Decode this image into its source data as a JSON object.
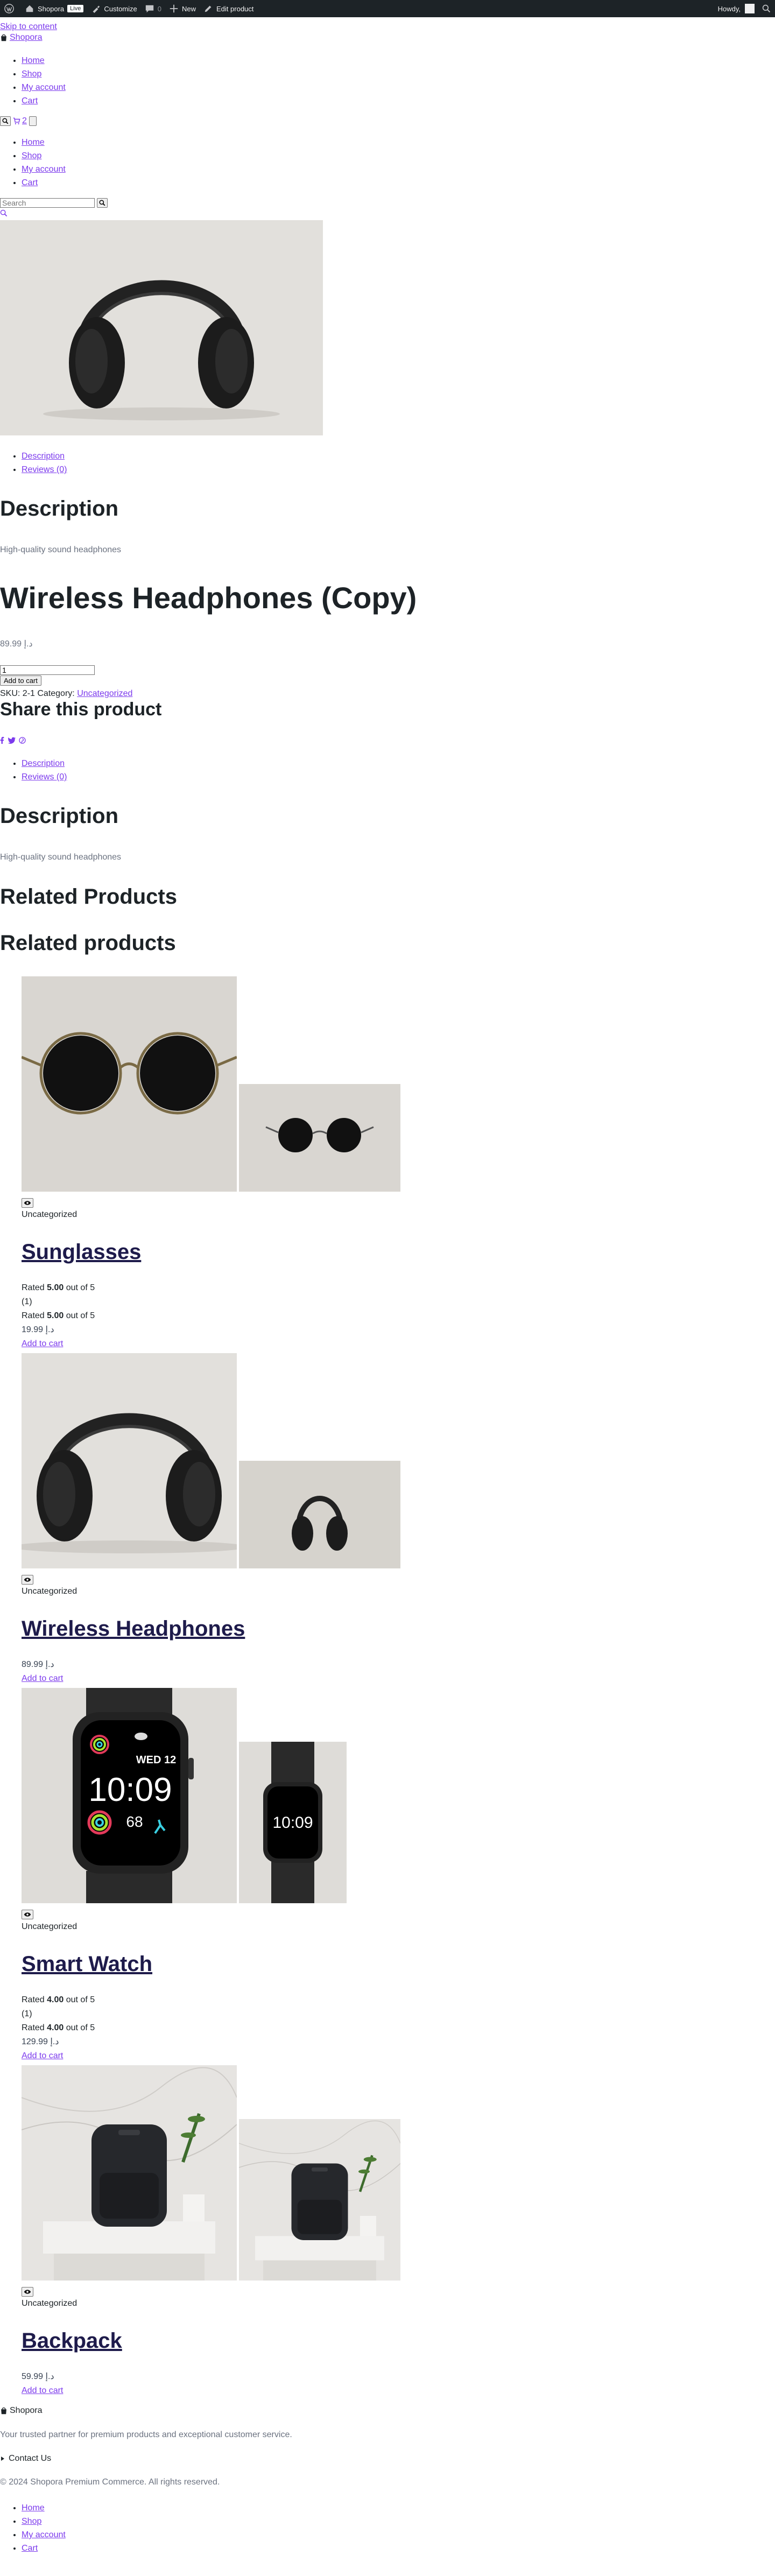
{
  "adminbar": {
    "site_name": "Shopora",
    "live_badge": "Live",
    "customize": "Customize",
    "comments_count": "0",
    "new_label": "New",
    "edit_product": "Edit product",
    "howdy": "Howdy,"
  },
  "header": {
    "skip_link": "Skip to content",
    "brand": "Shopora",
    "nav": [
      "Home",
      "Shop",
      "My account",
      "Cart"
    ],
    "cart_count": "2"
  },
  "search": {
    "placeholder": "Search"
  },
  "product": {
    "tabs": [
      "Description",
      "Reviews (0)"
    ],
    "description_heading": "Description",
    "description_text": "High-quality sound headphones",
    "title": "Wireless Headphones (Copy)",
    "price": "د.إ 89.99",
    "quantity": "1",
    "add_to_cart": "Add to cart",
    "sku_label": "SKU: 2-1 Category:",
    "category": "Uncategorized",
    "share_heading": "Share this product"
  },
  "related": {
    "heading1": "Related Products",
    "heading2": "Related products",
    "items": [
      {
        "category": "Uncategorized",
        "name": "Sunglasses",
        "rating_prefix": "Rated ",
        "rating_value": "5.00",
        "rating_suffix": " out of 5",
        "review_count": "(1)",
        "price": "د.إ 19.99",
        "cta": "Add to cart"
      },
      {
        "category": "Uncategorized",
        "name": "Wireless Headphones",
        "price": "د.إ 89.99",
        "cta": "Add to cart"
      },
      {
        "category": "Uncategorized",
        "name": "Smart Watch",
        "rating_prefix": "Rated ",
        "rating_value": "4.00",
        "rating_suffix": " out of 5",
        "review_count": "(1)",
        "price": "د.إ 129.99",
        "cta": "Add to cart",
        "watch_date": "WED 12",
        "watch_time": "10:09",
        "watch_number": "68"
      },
      {
        "category": "Uncategorized",
        "name": "Backpack",
        "price": "د.إ 59.99",
        "cta": "Add to cart"
      }
    ]
  },
  "footer": {
    "brand": "Shopora",
    "tagline": "Your trusted partner for premium products and exceptional customer service.",
    "contact": "Contact Us",
    "copyright": "© 2024 Shopora Premium Commerce. All rights reserved.",
    "nav": [
      "Home",
      "Shop",
      "My account",
      "Cart"
    ]
  },
  "colors": {
    "link": "#7c3aed",
    "adminbar": "#1d2327",
    "muted": "#6b7280"
  }
}
